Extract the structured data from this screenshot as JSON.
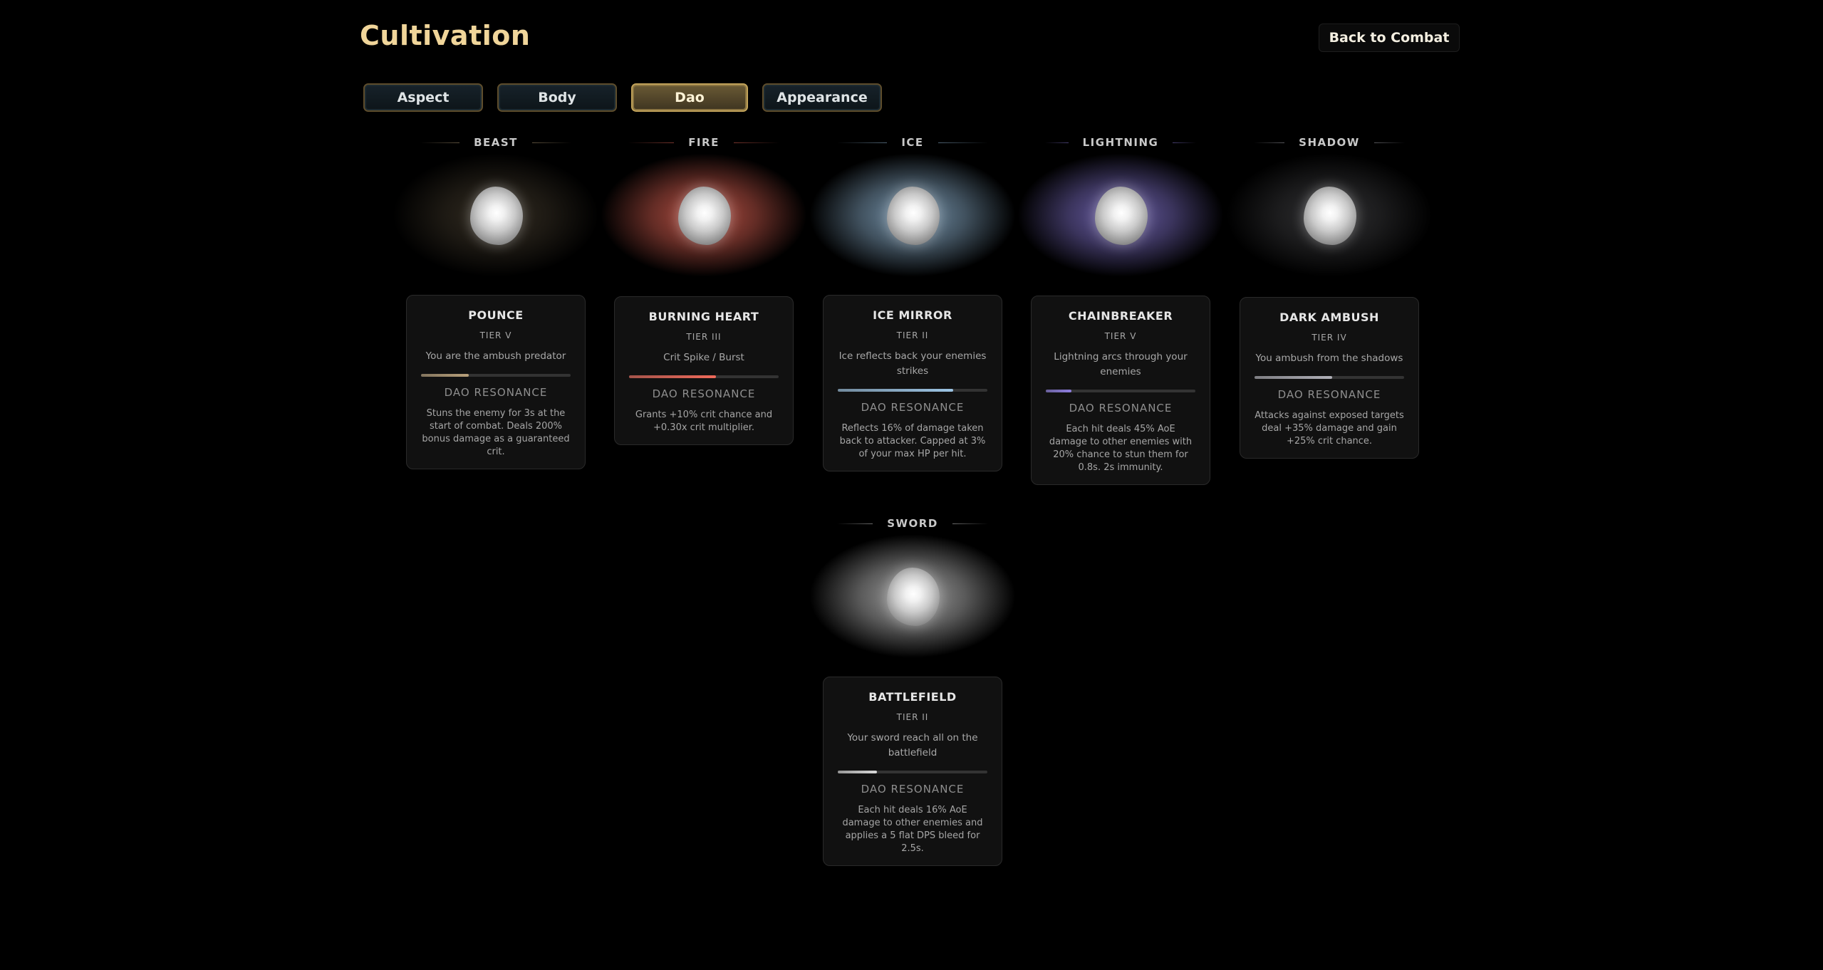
{
  "title": "Cultivation",
  "back_button": "Back to Combat",
  "tabs": [
    {
      "label": "Aspect",
      "active": false
    },
    {
      "label": "Body",
      "active": false
    },
    {
      "label": "Dao",
      "active": true
    },
    {
      "label": "Appearance",
      "active": false
    }
  ],
  "resonance_label": "DAO RESONANCE",
  "daos": [
    {
      "element": "BEAST",
      "color": "#b8a07a",
      "name": "POUNCE",
      "tier": "TIER V",
      "description": "You are the ambush predator",
      "progress": 0.32,
      "effect": "Stuns the enemy for 3s at the start of combat. Deals 200% bonus damage as a guaranteed crit."
    },
    {
      "element": "FIRE",
      "color": "#f06a5a",
      "name": "BURNING HEART",
      "tier": "TIER III",
      "description": "Crit Spike / Burst",
      "progress": 0.58,
      "effect": "Grants +10% crit chance and +0.30x crit multiplier."
    },
    {
      "element": "ICE",
      "color": "#9cc4e4",
      "name": "ICE MIRROR",
      "tier": "TIER II",
      "description": "Ice reflects back your enemies strikes",
      "progress": 0.77,
      "effect": "Reflects 16% of damage taken back to attacker. Capped at 3% of your max HP per hit."
    },
    {
      "element": "LIGHTNING",
      "color": "#8e7ee0",
      "name": "CHAINBREAKER",
      "tier": "TIER V",
      "description": "Lightning arcs through your enemies",
      "progress": 0.17,
      "effect": "Each hit deals 45% AoE damage to other enemies with 20% chance to stun them for 0.8s. 2s immunity."
    },
    {
      "element": "SHADOW",
      "color": "#b0b0b8",
      "name": "DARK AMBUSH",
      "tier": "TIER IV",
      "description": "You ambush from the shadows",
      "progress": 0.52,
      "effect": "Attacks against exposed targets deal +35% damage and gain +25% crit chance."
    },
    {
      "element": "SWORD",
      "color": "#d8d8d8",
      "name": "BATTLEFIELD",
      "tier": "TIER II",
      "description": "Your sword reach all on the battlefield",
      "progress": 0.26,
      "effect": "Each hit deals 16% AoE damage to other enemies and applies a 5 flat DPS bleed for 2.5s."
    }
  ]
}
